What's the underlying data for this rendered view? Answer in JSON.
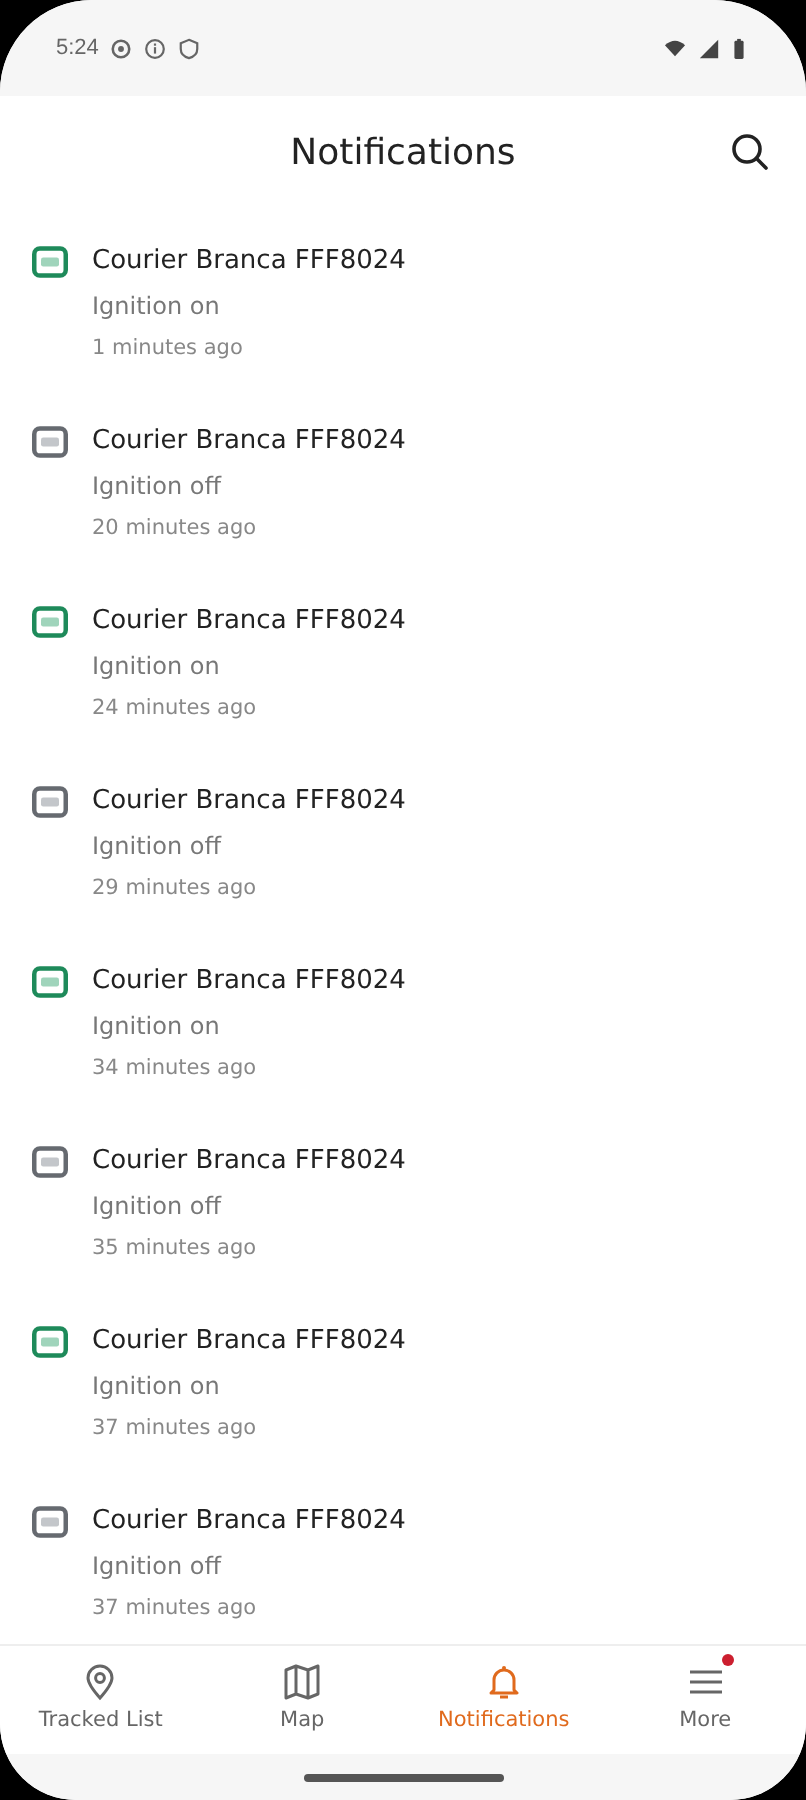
{
  "status_bar": {
    "time": "5:24"
  },
  "header": {
    "title": "Notifications"
  },
  "notifications": [
    {
      "kind": "on",
      "title": "Courier Branca FFF8024",
      "event": "Ignition on",
      "time": "1 minutes ago"
    },
    {
      "kind": "off",
      "title": "Courier Branca FFF8024",
      "event": "Ignition off",
      "time": "20 minutes ago"
    },
    {
      "kind": "on",
      "title": "Courier Branca FFF8024",
      "event": "Ignition on",
      "time": "24 minutes ago"
    },
    {
      "kind": "off",
      "title": "Courier Branca FFF8024",
      "event": "Ignition off",
      "time": "29 minutes ago"
    },
    {
      "kind": "on",
      "title": "Courier Branca FFF8024",
      "event": "Ignition on",
      "time": "34 minutes ago"
    },
    {
      "kind": "off",
      "title": "Courier Branca FFF8024",
      "event": "Ignition off",
      "time": "35 minutes ago"
    },
    {
      "kind": "on",
      "title": "Courier Branca FFF8024",
      "event": "Ignition on",
      "time": "37 minutes ago"
    },
    {
      "kind": "off",
      "title": "Courier Branca FFF8024",
      "event": "Ignition off",
      "time": "37 minutes ago"
    }
  ],
  "bottom_nav": [
    {
      "kind": "pin",
      "label": "Tracked List",
      "selected": false,
      "badge": false
    },
    {
      "kind": "map",
      "label": "Map",
      "selected": false,
      "badge": false
    },
    {
      "kind": "bell",
      "label": "Notifications",
      "selected": true,
      "badge": false
    },
    {
      "kind": "menu",
      "label": "More",
      "selected": false,
      "badge": true
    }
  ]
}
